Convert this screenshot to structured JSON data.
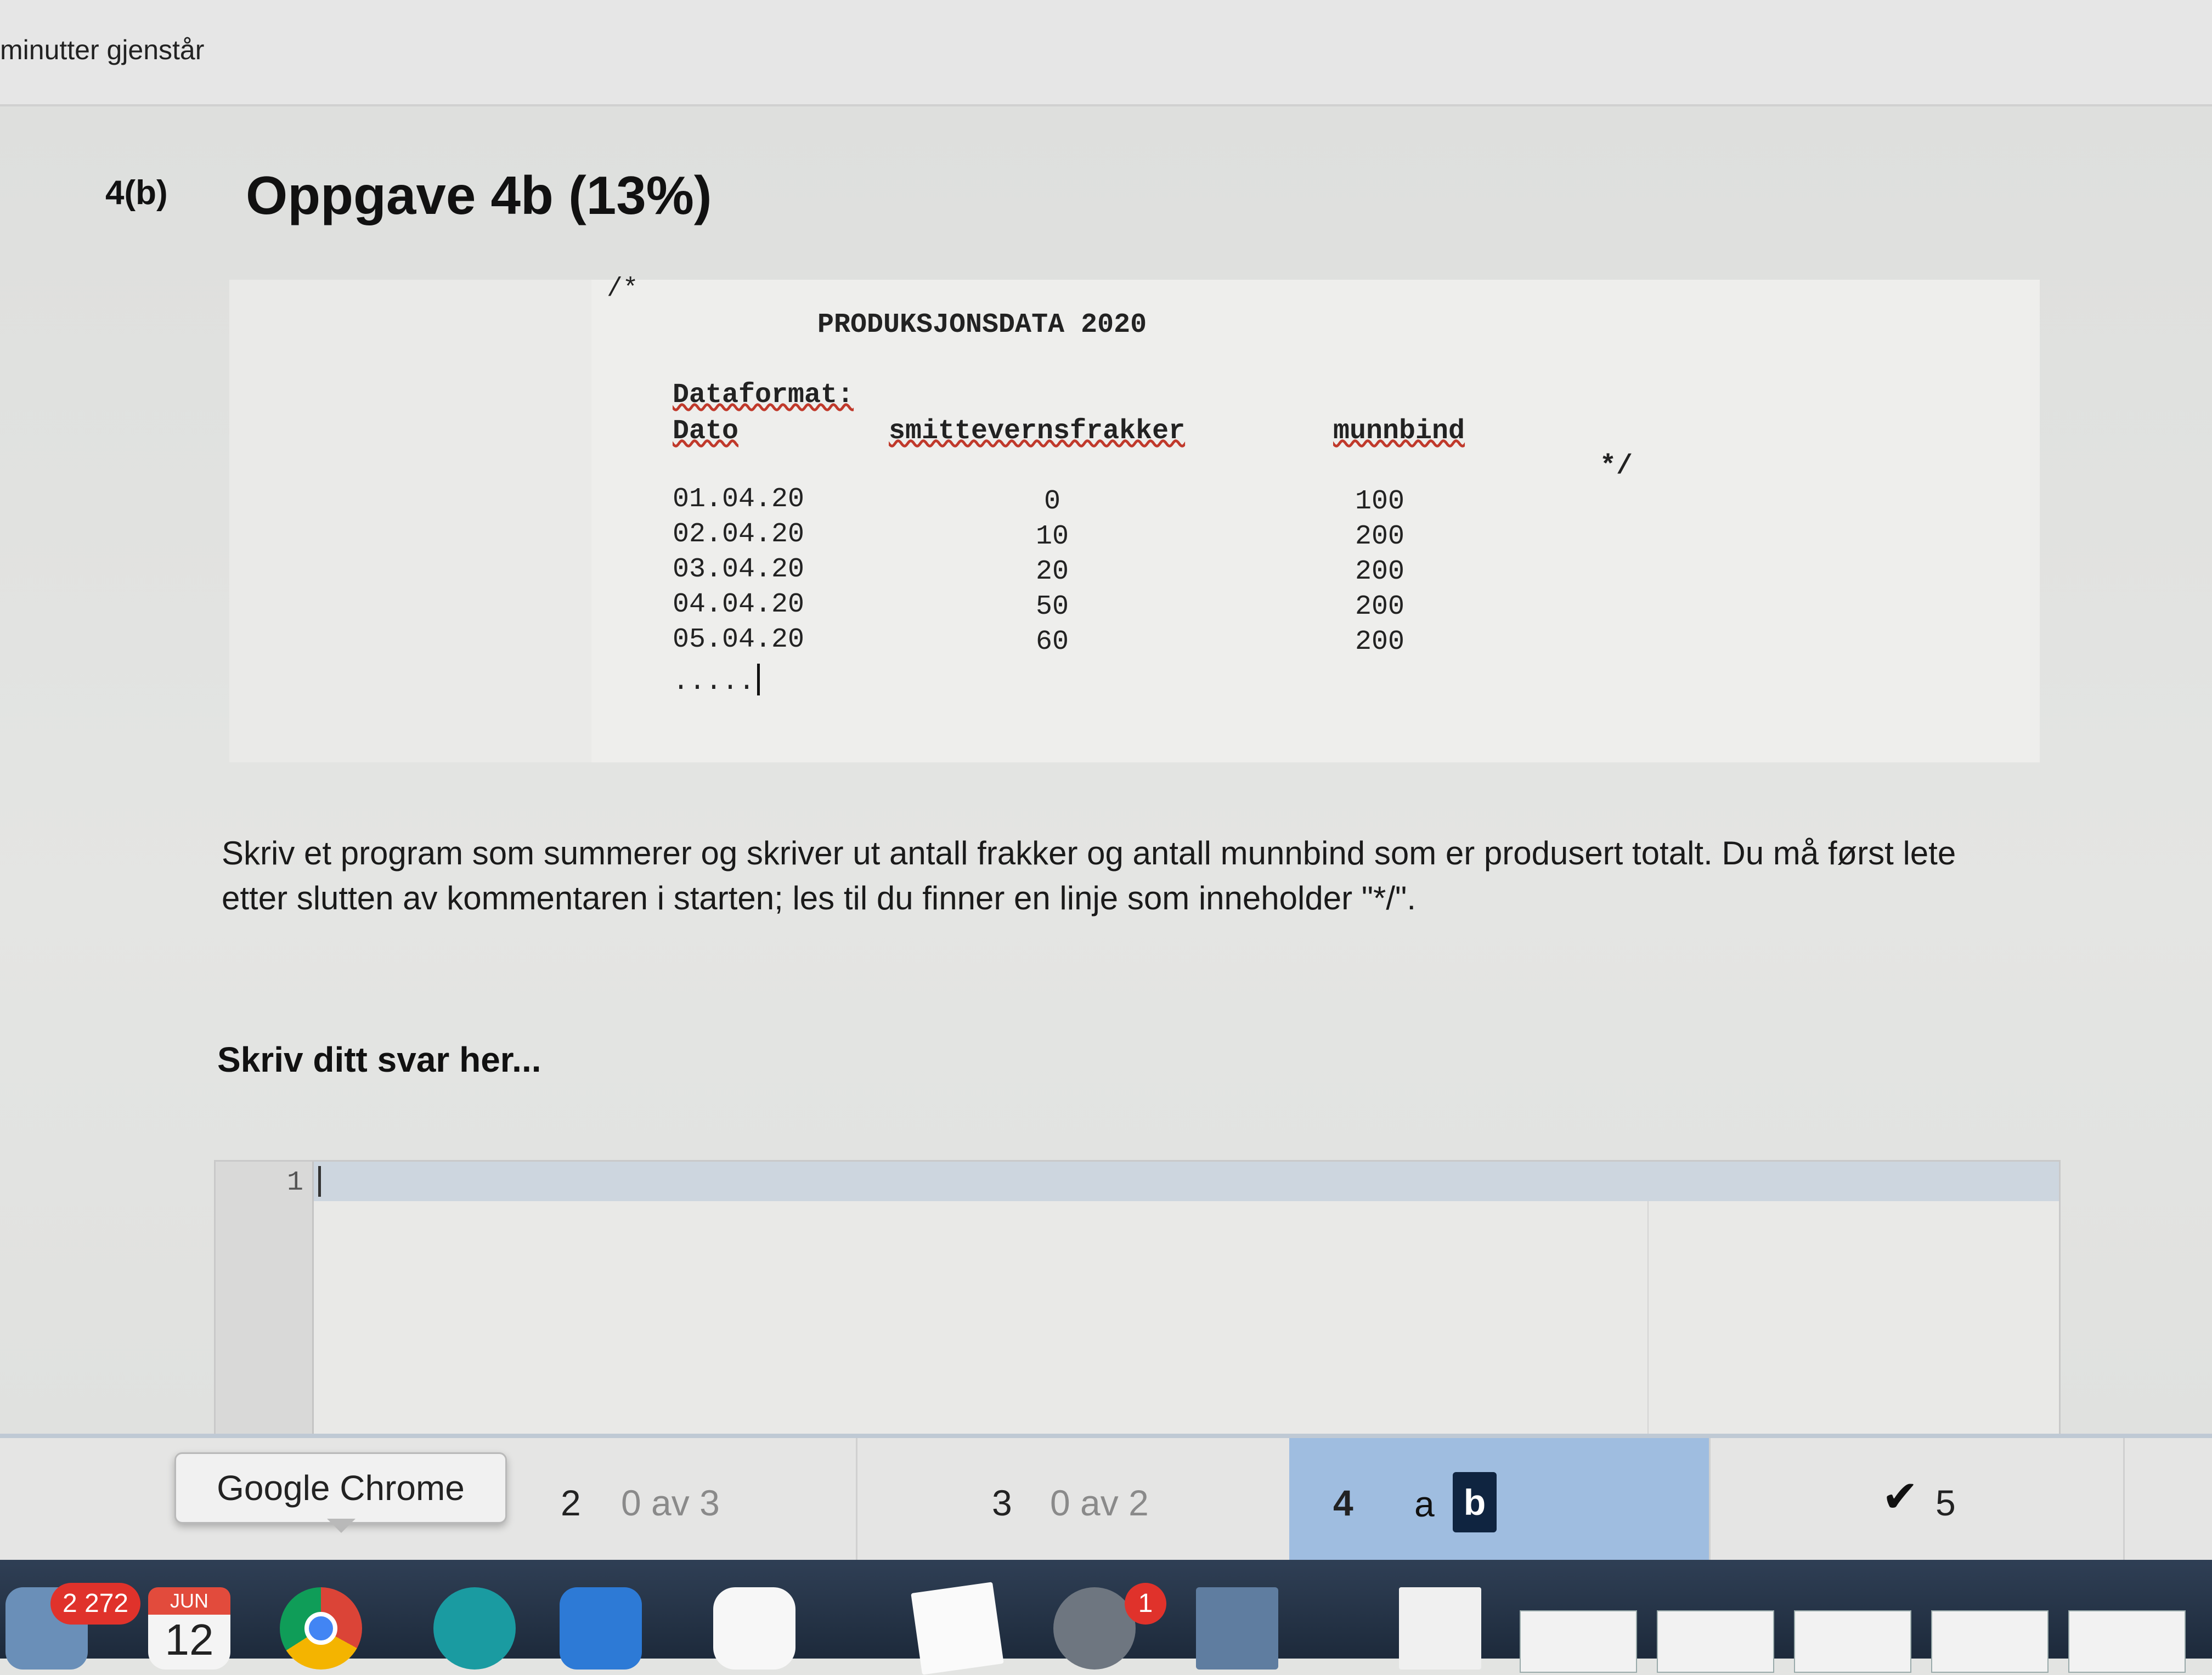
{
  "header": {
    "time_remaining": "minutter gjenstår"
  },
  "question": {
    "number": "4(b)",
    "title": "Oppgave 4b (13%)"
  },
  "figure": {
    "comment_open": "/*",
    "heading": "PRODUKSJONSDATA 2020",
    "format_label": "Dataformat:",
    "columns": [
      "Dato",
      "smittevernsfrakker",
      "munnbind"
    ],
    "comment_close": "*/",
    "rows": [
      [
        "01.04.20",
        "0",
        "100"
      ],
      [
        "02.04.20",
        "10",
        "200"
      ],
      [
        "03.04.20",
        "20",
        "200"
      ],
      [
        "04.04.20",
        "50",
        "200"
      ],
      [
        "05.04.20",
        "60",
        "200"
      ]
    ],
    "ellipsis": "....."
  },
  "description": "Skriv et program som summerer og skriver ut antall frakker og antall munnbind som er produsert totalt.  Du må først lete etter slutten av kommentaren i starten; les til du finner en linje som inneholder \"*/\".",
  "answer": {
    "label": "Skriv ditt svar her...",
    "line_number": "1"
  },
  "tooltip": "Google Chrome",
  "nav": [
    {
      "num": "2",
      "status": "0 av 3"
    },
    {
      "num": "3",
      "status": "0 av 2"
    },
    {
      "num": "4",
      "sub_a": "a",
      "sub_b": "b"
    },
    {
      "num": "5"
    }
  ],
  "dock": {
    "mail_badge": "2 272",
    "calendar_month": "JUN",
    "calendar_day": "12",
    "prefs_badge": "1"
  }
}
